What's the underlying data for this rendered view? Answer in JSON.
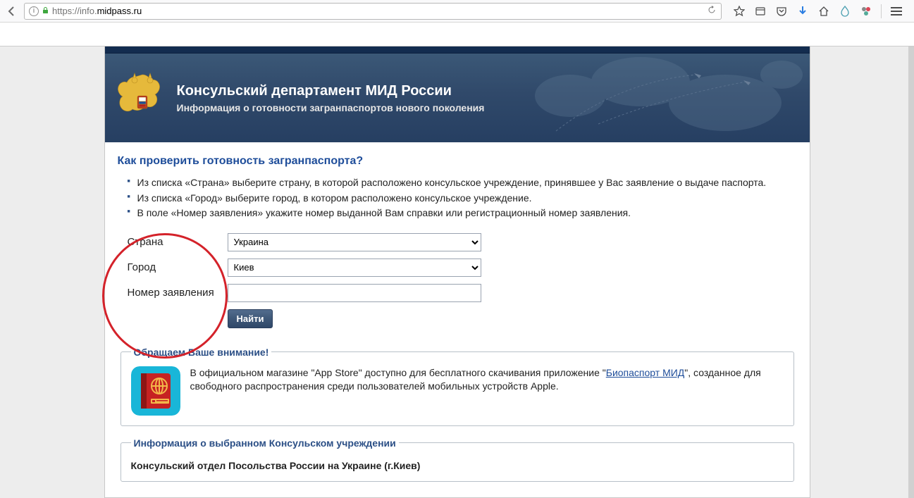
{
  "browser": {
    "url_prefix": "https://info.",
    "url_domain": "midpass.ru"
  },
  "header": {
    "title": "Консульский департамент МИД России",
    "subtitle": "Информация о готовности загранпаспортов нового поколения"
  },
  "question": "Как проверить готовность загранпаспорта?",
  "steps": [
    "Из списка «Страна» выберите страну, в которой расположено консульское учреждение, принявшее у Вас заявление о выдаче паспорта.",
    "Из списка «Город» выберите город, в котором расположено консульское учреждение.",
    "В поле «Номер заявления» укажите номер выданной Вам справки или регистрационный номер заявления."
  ],
  "form": {
    "country_label": "Страна",
    "country_value": "Украина",
    "city_label": "Город",
    "city_value": "Киев",
    "number_label": "Номер заявления",
    "number_value": "",
    "submit": "Найти"
  },
  "notice": {
    "legend": "Обращаем Ваше внимание!",
    "text_before": "В официальном магазине \"App Store\" доступно для бесплатного скачивания приложение \"",
    "link": "Биопаспорт МИД",
    "text_after": "\", созданное для свободного распространения среди пользователей мобильных устройств Apple."
  },
  "info": {
    "legend": "Информация о выбранном Консульском учреждении",
    "title": "Консульский отдел Посольства России на Украине (г.Киев)"
  }
}
